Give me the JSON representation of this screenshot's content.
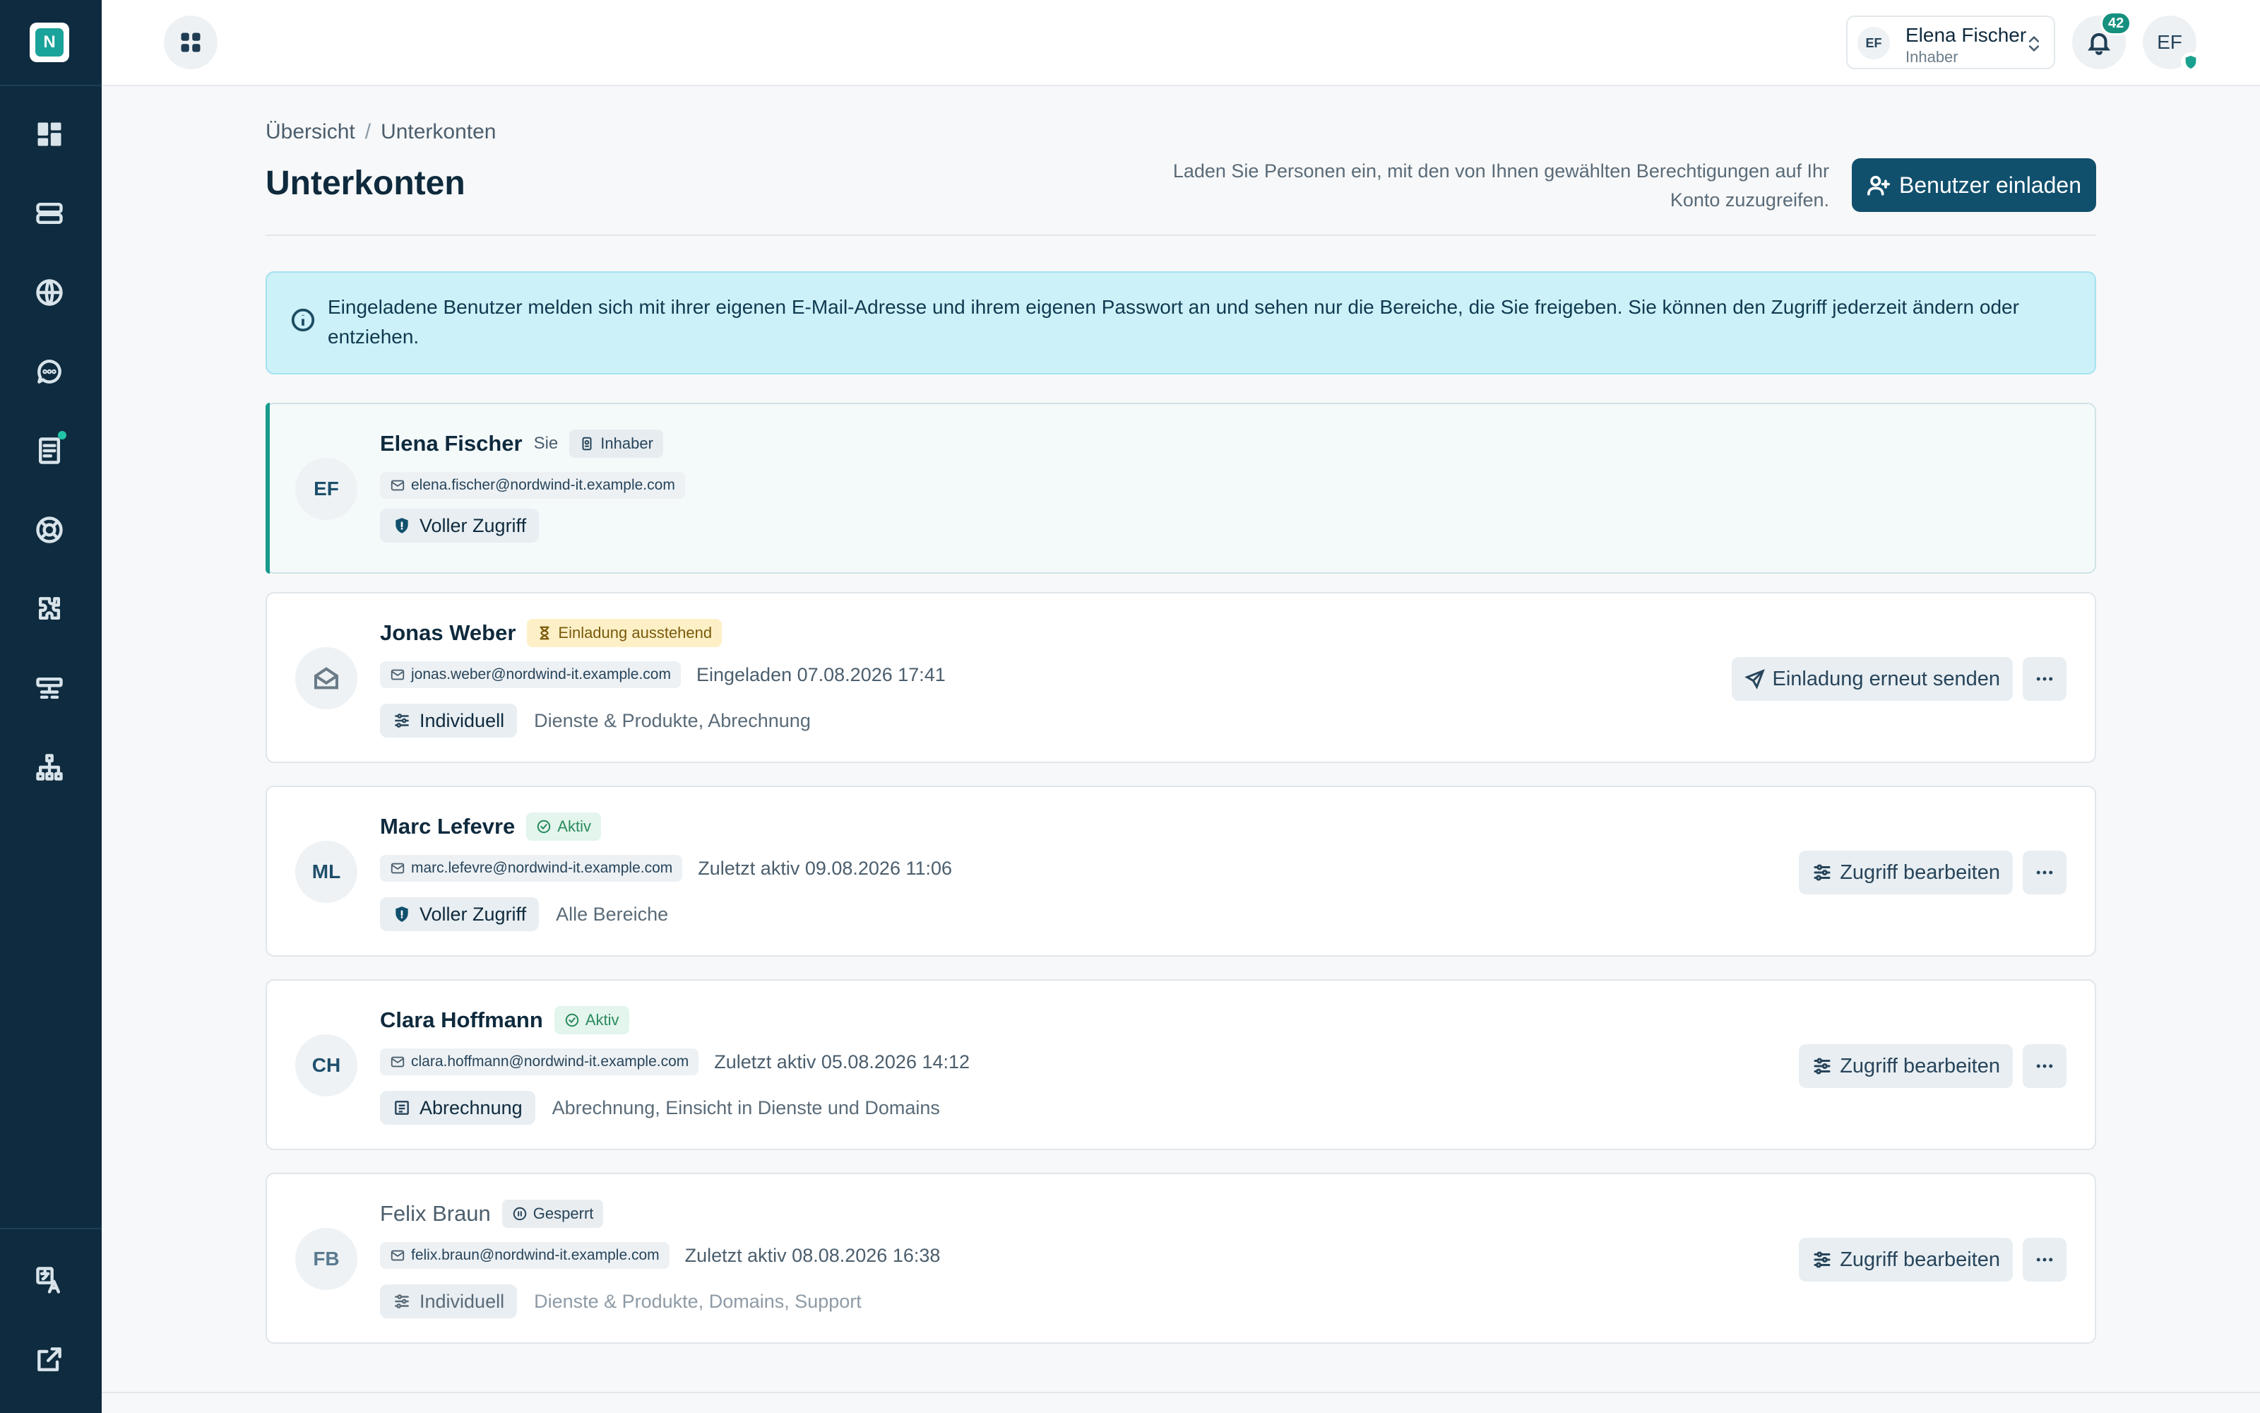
{
  "app": {
    "logo_letter": "N"
  },
  "topbar": {
    "account": {
      "initials": "EF",
      "name": "Elena Fischer",
      "role": "Inhaber"
    },
    "notifications": {
      "count": "42"
    },
    "user_initials": "EF"
  },
  "page": {
    "breadcrumb": [
      "Übersicht",
      "Unterkonten"
    ],
    "title": "Unterkonten",
    "description": "Laden Sie Personen ein, mit den von Ihnen gewählten Berechtigungen auf Ihr Konto zuzugreifen.",
    "invite_button": "Benutzer einladen",
    "info": "Eingeladene Benutzer melden sich mit ihrer eigenen E-Mail-Adresse und ihrem eigenen Passwort an und sehen nur die Bereiche, die Sie freigeben. Sie können den Zugriff jederzeit ändern oder entziehen."
  },
  "users": [
    {
      "initials": "EF",
      "name": "Elena Fischer",
      "you_label": "Sie",
      "status": "Inhaber",
      "email": "elena.fischer@nordwind-it.example.com",
      "meta": "",
      "access": "Voller Zugriff",
      "access_desc": ""
    },
    {
      "initials": "",
      "name": "Jonas Weber",
      "status": "Einladung ausstehend",
      "email": "jonas.weber@nordwind-it.example.com",
      "meta": "Eingeladen 07.08.2026 17:41",
      "access": "Individuell",
      "access_desc": "Dienste & Produkte, Abrechnung",
      "action": "Einladung erneut senden"
    },
    {
      "initials": "ML",
      "name": "Marc Lefevre",
      "status": "Aktiv",
      "email": "marc.lefevre@nordwind-it.example.com",
      "meta": "Zuletzt aktiv 09.08.2026 11:06",
      "access": "Voller Zugriff",
      "access_desc": "Alle Bereiche",
      "action": "Zugriff bearbeiten"
    },
    {
      "initials": "CH",
      "name": "Clara Hoffmann",
      "status": "Aktiv",
      "email": "clara.hoffmann@nordwind-it.example.com",
      "meta": "Zuletzt aktiv 05.08.2026 14:12",
      "access": "Abrechnung",
      "access_desc": "Abrechnung, Einsicht in Dienste und Domains",
      "action": "Zugriff bearbeiten"
    },
    {
      "initials": "FB",
      "name": "Felix Braun",
      "status": "Gesperrt",
      "email": "felix.braun@nordwind-it.example.com",
      "meta": "Zuletzt aktiv 08.08.2026 16:38",
      "access": "Individuell",
      "access_desc": "Dienste & Produkte, Domains, Support",
      "action": "Zugriff bearbeiten"
    }
  ],
  "sidebar": {
    "icons": [
      "dashboard-icon",
      "servers-icon",
      "globe-icon",
      "chat-icon",
      "invoice-icon",
      "support-icon",
      "extensions-icon",
      "network-icon",
      "sitemap-icon",
      "translate-icon",
      "external-link-icon"
    ]
  },
  "colors": {
    "sidebar": "#0e2b3f",
    "primary": "#11506d",
    "accent": "#179b8c",
    "info_bg": "#cdf1f8"
  }
}
